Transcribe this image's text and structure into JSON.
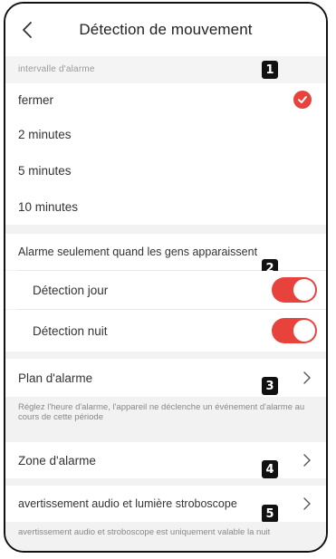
{
  "header": {
    "title": "Détection de mouvement"
  },
  "alarm_interval": {
    "section_label": "intervalle d'alarme",
    "options": [
      "fermer",
      "2 minutes",
      "5 minutes",
      "10 minutes"
    ],
    "selected_index": 0
  },
  "people_alarm": {
    "label": "Alarme seulement quand les gens apparaissent",
    "day_label": "Détection jour",
    "day_on": true,
    "night_label": "Détection nuit",
    "night_on": true
  },
  "schedule": {
    "label": "Plan d'alarme",
    "note": "Réglez l'heure d'alarme, l'appareil ne déclenche un événement d'alarme au cours de cette période"
  },
  "zone": {
    "label": "Zone d'alarme"
  },
  "strobe": {
    "label": "avertissement audio et lumière stroboscope",
    "note": "avertissement audio et stroboscope est uniquement valable la nuit"
  },
  "badges": [
    "1",
    "2",
    "3",
    "4",
    "5"
  ],
  "colors": {
    "accent": "#e8423d",
    "background": "#f2f2f2",
    "badge": "#111111"
  },
  "icons": {
    "back": "chevron-left-icon",
    "selected": "check-circle-icon",
    "disclosure": "chevron-right-icon"
  }
}
